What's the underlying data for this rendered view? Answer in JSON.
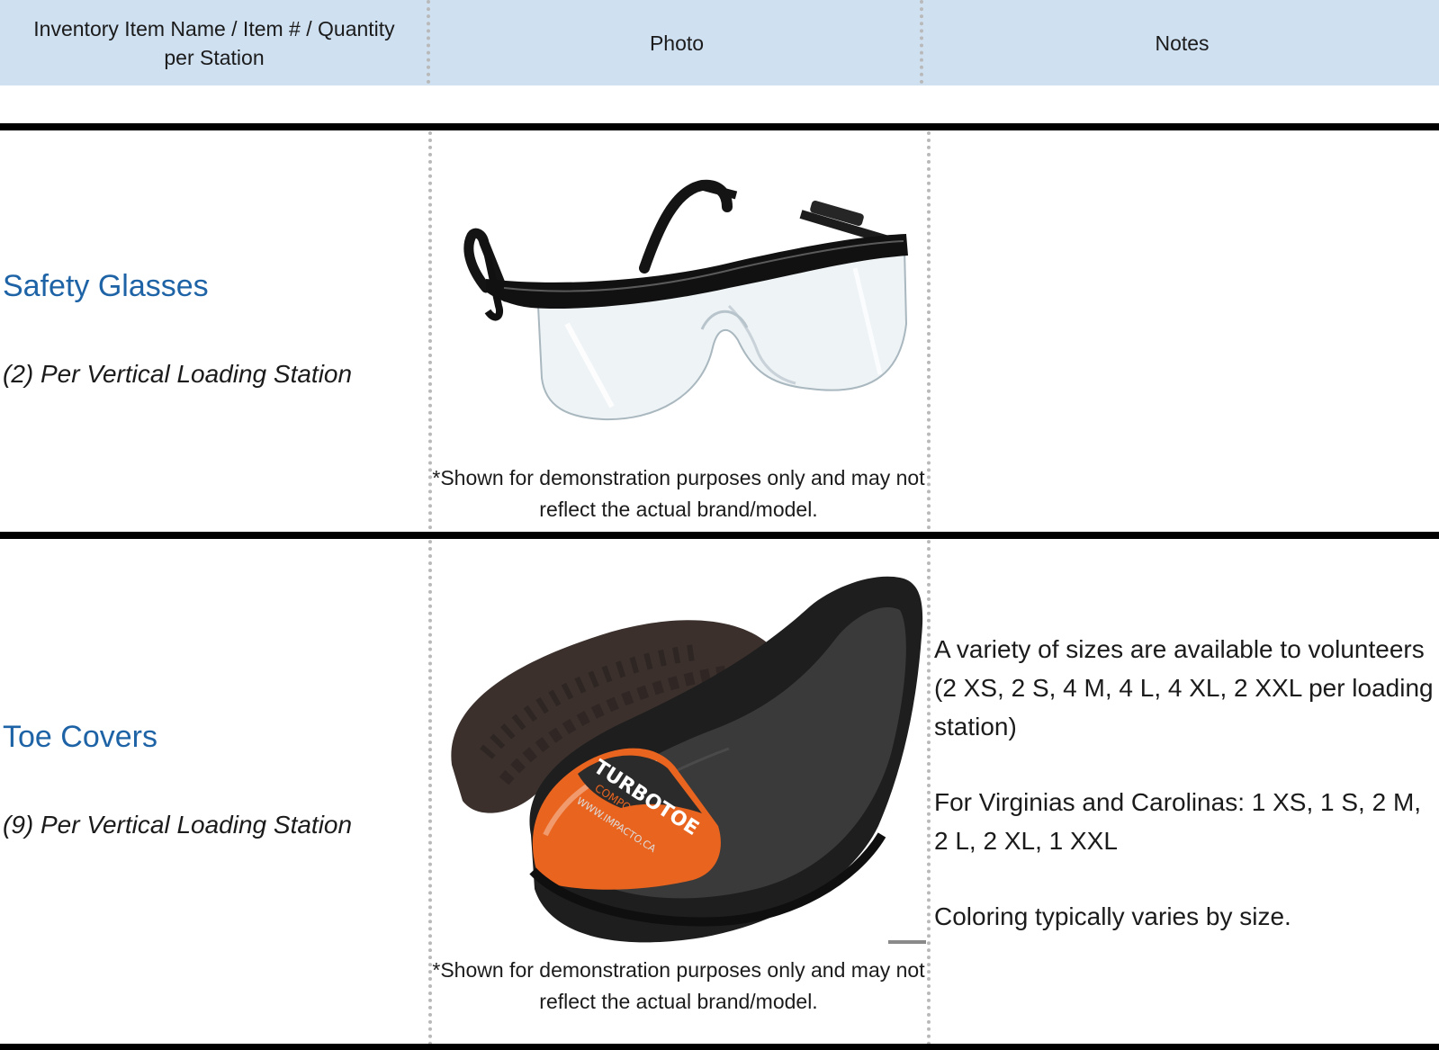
{
  "header": {
    "col1": "Inventory Item Name / Item # / Quantity per Station",
    "col2": "Photo",
    "col3": "Notes"
  },
  "rows": [
    {
      "name": "Safety Glasses",
      "quantity": "(2) Per Vertical Loading Station",
      "photo_icon": "safety-glasses-photo",
      "caption": "*Shown for demonstration purposes only and may not reflect the actual brand/model.",
      "notes": []
    },
    {
      "name": "Toe Covers",
      "quantity": "(9) Per Vertical Loading Station",
      "photo_icon": "toe-cover-photo",
      "photo_text": {
        "brand": "TURBOTOE",
        "sub": "COMPOSITE",
        "url": "WWW.IMPACTO.CA"
      },
      "caption": "*Shown for demonstration purposes only and may not reflect the actual brand/model.",
      "notes": [
        "A variety of sizes are available to volunteers (2 XS, 2 S, 4 M, 4 L, 4 XL, 2 XXL per loading station)",
        "For Virginias and Carolinas: 1 XS, 1 S, 2 M, 2 L, 2 XL, 1 XXL",
        "Coloring typically varies by size."
      ]
    }
  ],
  "colors": {
    "header_bg": "#cfe0f1",
    "item_name": "#1d63a6",
    "toe_accent": "#e9641f"
  }
}
